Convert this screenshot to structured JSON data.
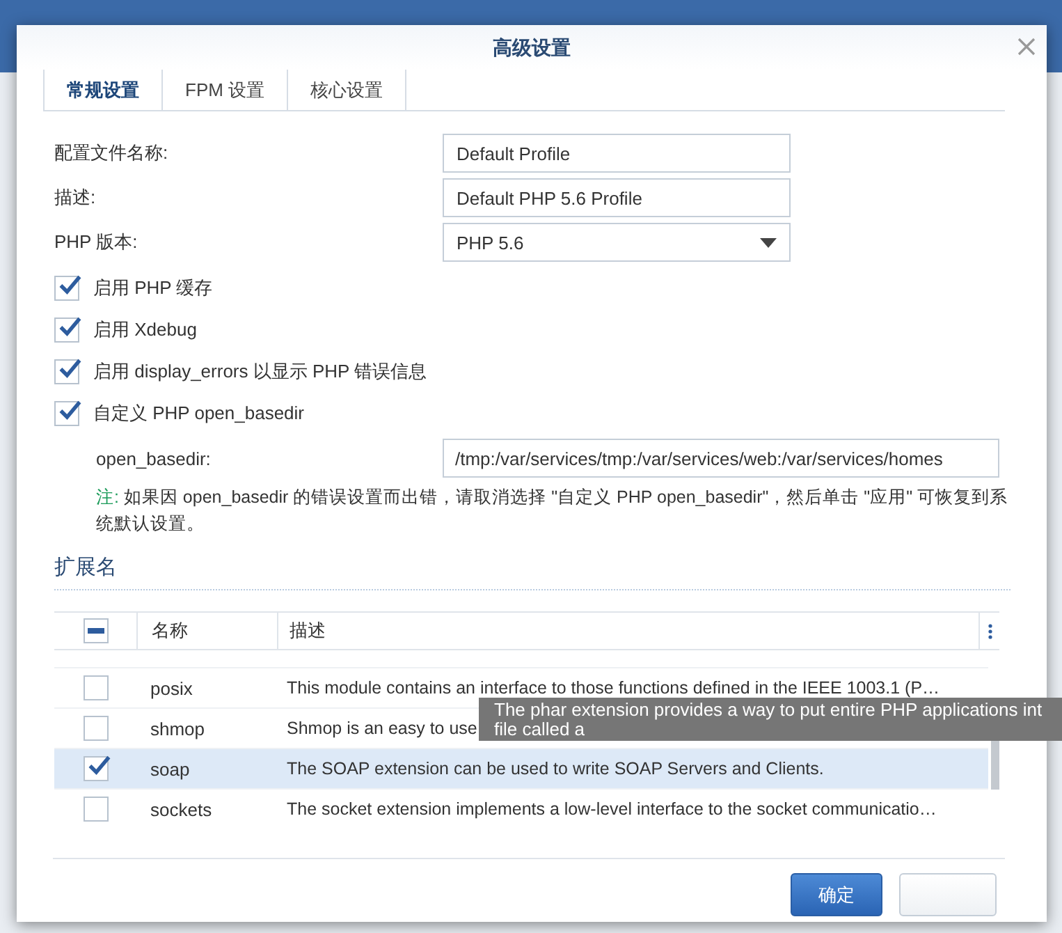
{
  "window": {
    "title": "高级设置"
  },
  "tabs": [
    {
      "label": "常规设置",
      "selected": true
    },
    {
      "label": "FPM 设置",
      "selected": false
    },
    {
      "label": "核心设置",
      "selected": false
    }
  ],
  "fields": [
    {
      "label": "配置文件名称:",
      "value": "Default Profile",
      "kind": "text"
    },
    {
      "label": "描述:",
      "value": "Default PHP 5.6 Profile",
      "kind": "text"
    },
    {
      "label": "PHP 版本:",
      "value": "PHP 5.6",
      "kind": "select"
    }
  ],
  "options": [
    {
      "label": "启用 PHP 缓存",
      "checked": true
    },
    {
      "label": "启用 Xdebug",
      "checked": true
    },
    {
      "label": "启用 display_errors 以显示 PHP 错误信息",
      "checked": true
    },
    {
      "label": "自定义 PHP open_basedir",
      "checked": true
    }
  ],
  "open_basedir": {
    "label": "open_basedir:",
    "value": "/tmp:/var/services/tmp:/var/services/web:/var/services/homes"
  },
  "note": {
    "prefix": "注:",
    "text": " 如果因 open_basedir 的错误设置而出错，请取消选择 \"自定义 PHP open_basedir\"，然后单击 \"应用\" 可恢复到系统默认设置。"
  },
  "extensions": {
    "title": "扩展名",
    "header_checkbox": {
      "indeterminate": true
    },
    "columns": [
      "名称",
      "描述"
    ],
    "rows": [
      {
        "name": "posix",
        "description": "This module contains an interface to those functions defined in the IEEE 1003.1 (P…",
        "checked": false,
        "selected": false
      },
      {
        "name": "shmop",
        "description": "Shmop is an easy to use",
        "checked": false,
        "selected": false
      },
      {
        "name": "soap",
        "description": "The SOAP extension can be used to write SOAP Servers and Clients.",
        "checked": true,
        "selected": true
      },
      {
        "name": "sockets",
        "description": "The socket extension implements a low-level interface to the socket communicatio…",
        "checked": false,
        "selected": false
      }
    ],
    "tooltip": [
      "The phar extension provides a way to put entire PHP applications int",
      "file called a"
    ]
  },
  "buttons": [
    {
      "label": "确定",
      "kind": "primary"
    },
    {
      "kind": "secondary"
    }
  ]
}
